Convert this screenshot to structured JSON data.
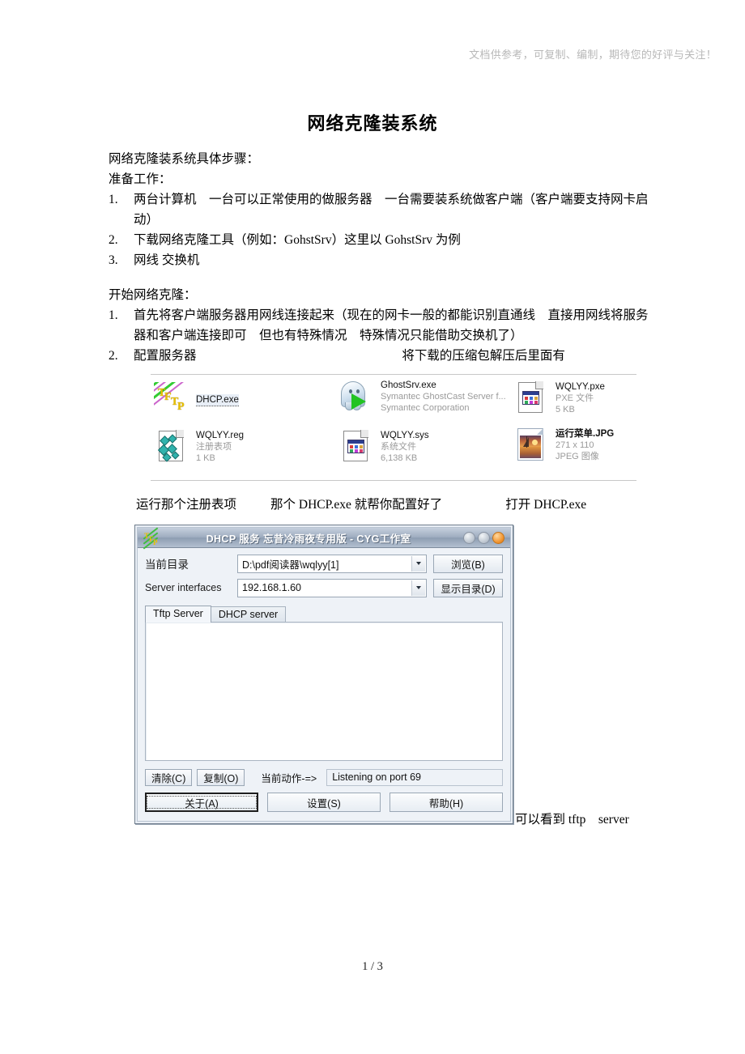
{
  "watermark": "文档供参考，可复制、编制，期待您的好评与关注！",
  "title": "网络克隆装系统",
  "intro": {
    "line1": "网络克隆装系统具体步骤：",
    "line2": "准备工作："
  },
  "prep_steps": [
    {
      "num": "1.",
      "text": "两台计算机　一台可以正常使用的做服务器　一台需要装系统做客户端（客户端要支持网卡启动）"
    },
    {
      "num": "2.",
      "text": "下载网络克隆工具（例如：GohstSrv）这里以 GohstSrv 为例"
    },
    {
      "num": "3.",
      "text": "网线 交换机"
    }
  ],
  "clone": {
    "heading": "开始网络克隆："
  },
  "clone_steps": [
    {
      "num": "1.",
      "text": "首先将客户端服务器用网线连接起来（现在的网卡一般的都能识别直通线　直接用网线将服务器和客户端连接即可　但也有特殊情况　特殊情况只能借助交换机了）"
    },
    {
      "num": "2.",
      "text": "配置服务器",
      "tail": "将下载的压缩包解压后里面有"
    }
  ],
  "files": [
    {
      "name": "DHCP.exe",
      "meta1": "",
      "meta2": "",
      "icon": "tftp-icon",
      "selected": true
    },
    {
      "name": "GhostSrv.exe",
      "meta1": "Symantec GhostCast Server f...",
      "meta2": "Symantec Corporation",
      "icon": "ghost-icon",
      "selected": false
    },
    {
      "name": "WQLYY.pxe",
      "meta1": "PXE 文件",
      "meta2": "5 KB",
      "icon": "pxe-file-icon",
      "selected": false
    },
    {
      "name": "WQLYY.reg",
      "meta1": "注册表项",
      "meta2": "1 KB",
      "icon": "registry-file-icon",
      "selected": false
    },
    {
      "name": "WQLYY.sys",
      "meta1": "系统文件",
      "meta2": "6,138 KB",
      "icon": "system-file-icon",
      "selected": false
    },
    {
      "name": "运行菜单.JPG",
      "meta1": "271 x 110",
      "meta2": "JPEG 图像",
      "icon": "jpeg-image-icon",
      "selected": false
    }
  ],
  "caption": {
    "seg1": "运行那个注册表项",
    "seg2": "那个 DHCP.exe 就帮你配置好了",
    "seg3": "打开 DHCP.exe"
  },
  "dhcp_window": {
    "title": "DHCP 服务 忘昔冷雨夜专用版 - CYG工作室",
    "fields": [
      {
        "label": "当前目录",
        "value": "D:\\pdf阅读器\\wqlyy[1]",
        "button": "浏览(B)",
        "button_key": "B"
      },
      {
        "label": "Server interfaces",
        "value": "192.168.1.60",
        "button": "显示目录(D)",
        "button_key": "D"
      }
    ],
    "tabs": [
      {
        "label": "Tftp Server",
        "active": true
      },
      {
        "label": "DHCP server",
        "active": false
      }
    ],
    "log": "",
    "status": {
      "clear_button": "清除(C)",
      "copy_button": "复制(O)",
      "action_label": "当前动作-=>",
      "action_value": "Listening on port 69"
    },
    "buttons": [
      {
        "label": "关于(A)",
        "focused": true
      },
      {
        "label": "设置(S)",
        "focused": false
      },
      {
        "label": "帮助(H)",
        "focused": false
      }
    ]
  },
  "trailing_text": "可以看到 tftp　server",
  "footer": "1 / 3"
}
